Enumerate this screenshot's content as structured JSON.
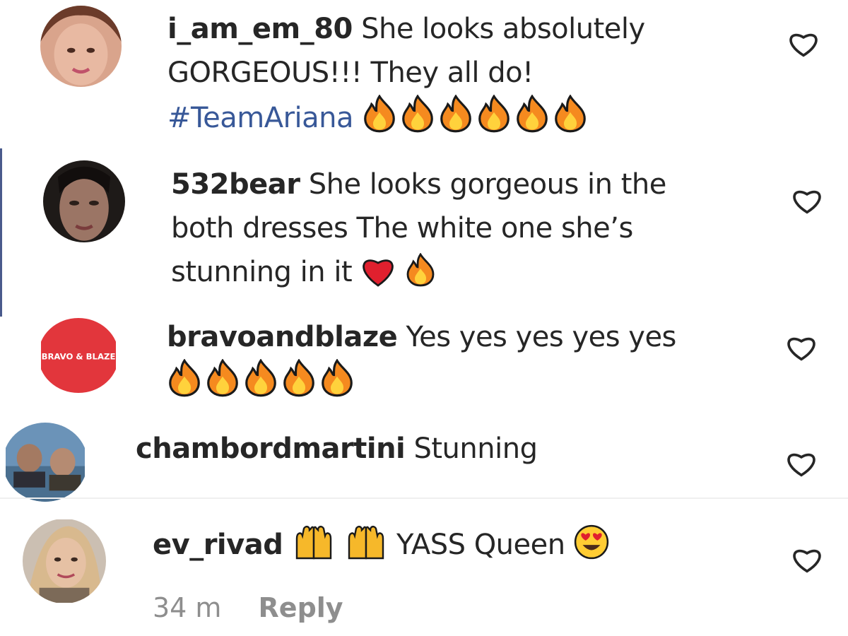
{
  "comments": [
    {
      "username": "i_am_em_80",
      "text_part1": "She looks absolutely",
      "text_part2": "GORGEOUS!!! They all do!",
      "hashtag": "#TeamAriana",
      "emojis": [
        "fire",
        "fire",
        "fire",
        "fire",
        "fire",
        "fire"
      ]
    },
    {
      "username": "532bear",
      "text_part1": "She looks gorgeous in the",
      "text_part2": "both dresses The white one she’s",
      "text_part3": "stunning in it",
      "emojis": [
        "red-heart",
        "fire"
      ]
    },
    {
      "username": "bravoandblaze",
      "text_part1": "Yes yes yes yes yes",
      "avatar_text": "BRAVO & BLAZE",
      "emojis": [
        "fire",
        "fire",
        "fire",
        "fire",
        "fire"
      ]
    },
    {
      "username": "chambordmartini",
      "text_part1": "Stunning"
    },
    {
      "username": "ev_rivad",
      "text_part1": "YASS Queen",
      "emojis_before": [
        "raising-hands",
        "raising-hands"
      ],
      "emojis_after": [
        "heart-eyes"
      ],
      "time": "34 m",
      "reply_label": "Reply"
    }
  ],
  "colors": {
    "text": "#262626",
    "hashtag": "#385898",
    "muted": "#8e8e8e",
    "like_outline": "#262626"
  },
  "icons": {
    "like": "heart-outline-icon",
    "fire": "fire-emoji",
    "red-heart": "red-heart-emoji",
    "raising-hands": "raising-hands-emoji",
    "heart-eyes": "heart-eyes-emoji"
  }
}
